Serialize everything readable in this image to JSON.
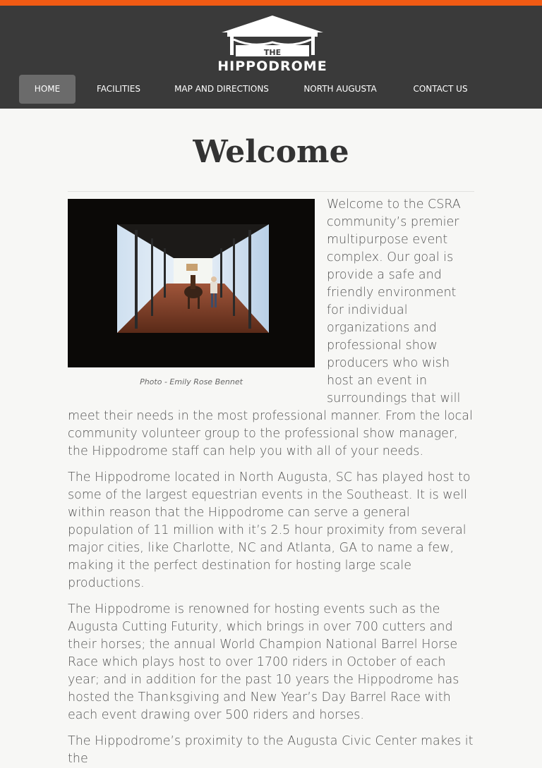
{
  "header": {
    "logo": {
      "small": "THE",
      "name": "HIPPODROME"
    },
    "nav": [
      {
        "label": "HOME",
        "active": true
      },
      {
        "label": "FACILITIES",
        "active": false
      },
      {
        "label": "MAP AND DIRECTIONS",
        "active": false
      },
      {
        "label": "NORTH AUGUSTA",
        "active": false
      },
      {
        "label": "CONTACT US",
        "active": false
      }
    ]
  },
  "main": {
    "title": "Welcome",
    "photo_caption": "Photo - Emily Rose Bennet",
    "paragraphs": [
      "Welcome to the CSRA community’s premier multipurpose event complex. Our goal is provide a safe and friendly environment for individual organizations and professional show producers who wish host an event in surroundings that will meet their needs in the most professional manner. From the local community volunteer group to the professional show manager, the Hippodrome staff can help you with all of your needs.",
      "The Hippodrome located in North Augusta, SC has played host to some of the largest equestrian events in the Southeast. It is well within reason that the Hippodrome can serve a general population of 11 million with it’s 2.5 hour proximity from several major cities, like Charlotte, NC and Atlanta, GA to name a few, making it the perfect destination for hosting large scale productions.",
      "The Hippodrome is renowned for hosting events such as the Augusta Cutting Futurity, which brings in over 700 cutters and their horses; the annual World Champion National Barrel Horse Race which plays host to over 1700 riders in October of each year; and in addition for the past 10 years the Hippodrome has hosted the Thanksgiving and New Year’s Day Barrel Race with each event drawing over 500 riders and horses.",
      "The Hippodrome’s proximity to the Augusta Civic Center makes it the"
    ]
  },
  "colors": {
    "accent": "#f05a14",
    "header_bg": "#3a3a3a",
    "nav_active": "#6b6b6b"
  }
}
